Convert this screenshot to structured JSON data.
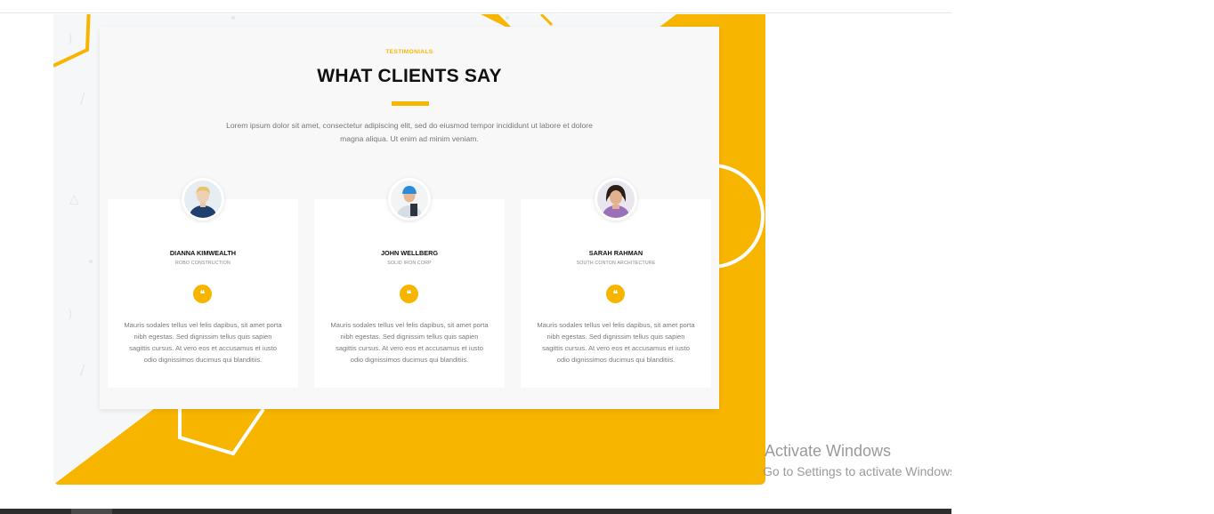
{
  "colors": {
    "accent": "#f7b500",
    "panel": "#f8f8f9",
    "heading": "#111111"
  },
  "section": {
    "kicker": "TESTIMONIALS",
    "heading": "WHAT CLIENTS SAY",
    "intro": "Lorem ipsum dolor sit amet, consectetur adipiscing elit, sed do eiusmod tempor incididunt ut labore et dolore magna aliqua. Ut enim ad minim veniam."
  },
  "testimonials": [
    {
      "name": "DIANNA KIMWEALTH",
      "company": "ROBO CONSTRUCTION",
      "quote_icon": "quote-icon",
      "text": "Mauris sodales tellus vel felis dapibus, sit amet porta nibh egestas. Sed dignissim tellus quis sapien sagittis cursus. At vero eos et accusamus et iusto odio dignissimos ducimus qui blanditiis."
    },
    {
      "name": "JOHN WELLBERG",
      "company": "SOLID IRON CORP",
      "quote_icon": "quote-icon",
      "text": "Mauris sodales tellus vel felis dapibus, sit amet porta nibh egestas. Sed dignissim tellus quis sapien sagittis cursus. At vero eos et accusamus et iusto odio dignissimos ducimus qui blanditiis."
    },
    {
      "name": "SARAH RAHMAN",
      "company": "SOUTH CONTON ARCHITECTURE",
      "quote_icon": "quote-icon",
      "text": "Mauris sodales tellus vel felis dapibus, sit amet porta nibh egestas. Sed dignissim tellus quis sapien sagittis cursus. At vero eos et accusamus et iusto odio dignissimos ducimus qui blanditiis."
    }
  ],
  "watermark": {
    "line1": "Activate Windows",
    "line2": "Go to Settings to activate Windows."
  },
  "quote_glyph": "❝"
}
